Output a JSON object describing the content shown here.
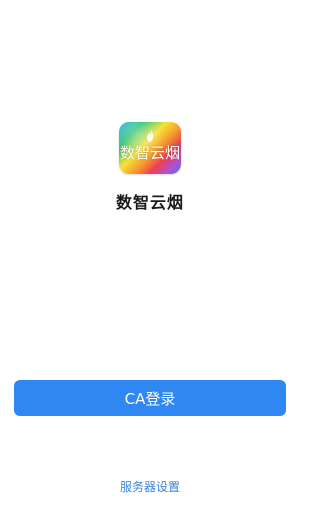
{
  "app": {
    "logo_text": "数智云烟",
    "name": "数智云烟"
  },
  "actions": {
    "ca_login_label": "CA登录",
    "server_settings_label": "服务器设置"
  },
  "colors": {
    "primary": "#2f87f2",
    "link": "#3a86d6",
    "background": "#ffffff"
  },
  "icons": {
    "logo": "app-logo-icon",
    "flame": "flame-icon"
  }
}
